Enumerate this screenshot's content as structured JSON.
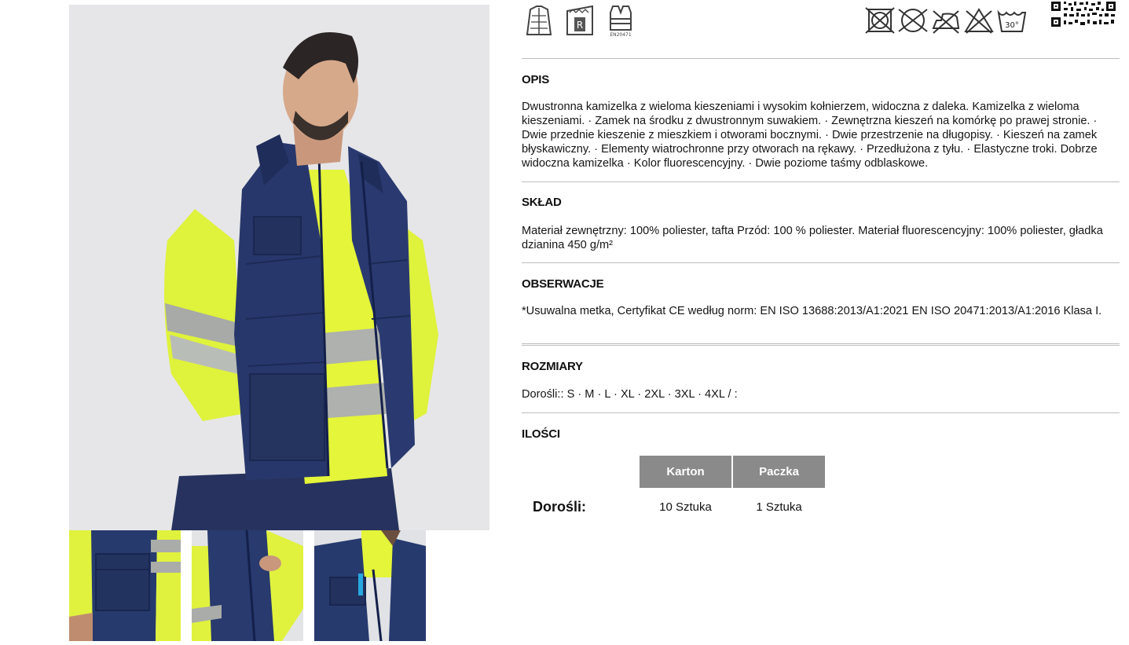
{
  "sections": {
    "opis": {
      "title": "OPIS",
      "text": "Dwustronna kamizelka z wieloma kieszeniami i wysokim kołnierzem, widoczna z daleka. Kamizelka z wieloma kieszeniami. · Zamek na środku z dwustronnym suwakiem. · Zewnętrzna kieszeń na komórkę po prawej stronie. · Dwie przednie kieszenie z mieszkiem i otworami bocznymi. · Dwie przestrzenie na długopisy. · Kieszeń na zamek błyskawiczny. · Elementy wiatrochronne przy otworach na rękawy. · Przedłużona z tyłu. · Elastyczne troki. Dobrze widoczna kamizelka · Kolor fluorescencyjny. · Dwie poziome taśmy odblaskowe."
    },
    "sklad": {
      "title": "SKŁAD",
      "text": "Materiał zewnętrzny: 100% poliester, tafta Przód: 100 % poliester. Materiał fluorescencyjny: 100% poliester, gładka dzianina 450 g/m²"
    },
    "obserwacje": {
      "title": "OBSERWACJE",
      "text": "*Usuwalna metka, Certyfikat CE według norm: EN ISO 13688:2013/A1:2021 EN ISO 20471:2013/A1:2016 Klasa I."
    },
    "rozmiary": {
      "title": "ROZMIARY",
      "text": "Dorośli:: S · M · L · XL · 2XL · 3XL · 4XL / :"
    },
    "ilosci": {
      "title": "ILOŚCI",
      "columns": [
        "Karton",
        "Paczka"
      ],
      "rows": [
        {
          "label": "Dorośli:",
          "values": [
            "10 Sztuka",
            "1 Sztuka"
          ]
        }
      ]
    }
  },
  "icons": {
    "product": [
      "reversible-jacket-icon",
      "removable-label-icon",
      "en20471-vest-icon"
    ],
    "en_label": "EN20471",
    "care": [
      "no-dry-clean-icon",
      "no-tumble-dry-icon",
      "no-iron-icon",
      "no-bleach-icon",
      "wash-30-icon"
    ],
    "wash_temp": "30°"
  },
  "colors": {
    "navy": "#263a6e",
    "fluo_yellow": "#e4f53a",
    "reflective": "#a9aca8",
    "table_header": "#8a8a8a",
    "rule": "#bdbdbd"
  }
}
